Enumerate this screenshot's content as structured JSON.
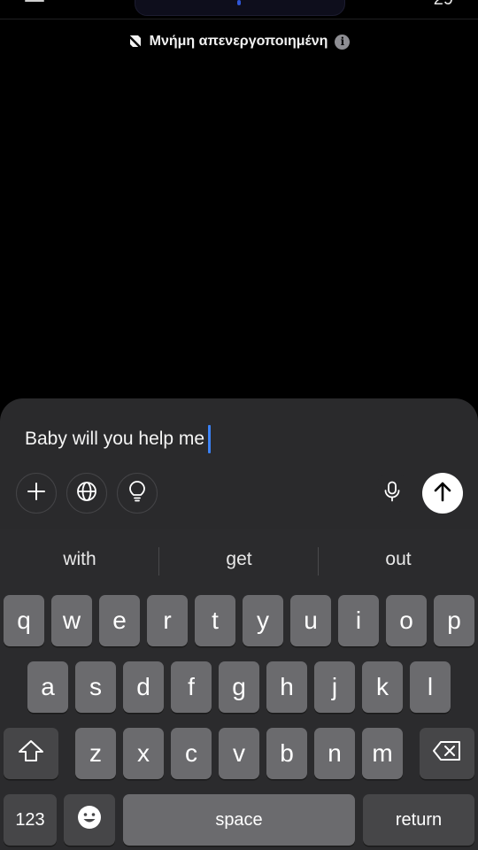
{
  "header": {
    "right_text": "29",
    "memory_status": "Μνήμη απενεργοποιημένη",
    "info_icon": "i"
  },
  "composer": {
    "input_text": "Baby will you help me",
    "icons": [
      "plus-icon",
      "globe-icon",
      "lightbulb-icon",
      "microphone-icon",
      "arrow-up-icon"
    ]
  },
  "keyboard": {
    "suggestions": [
      "with",
      "get",
      "out"
    ],
    "row1": [
      "q",
      "w",
      "e",
      "r",
      "t",
      "y",
      "u",
      "i",
      "o",
      "p"
    ],
    "row2": [
      "a",
      "s",
      "d",
      "f",
      "g",
      "h",
      "j",
      "k",
      "l"
    ],
    "row3": [
      "z",
      "x",
      "c",
      "v",
      "b",
      "n",
      "m"
    ],
    "numbers_label": "123",
    "space_label": "space",
    "return_label": "return"
  },
  "colors": {
    "background": "#000000",
    "composer": "#2a2a2c",
    "key": "#6b6b6e",
    "key_dark": "#464648",
    "caret": "#3b82f6"
  }
}
